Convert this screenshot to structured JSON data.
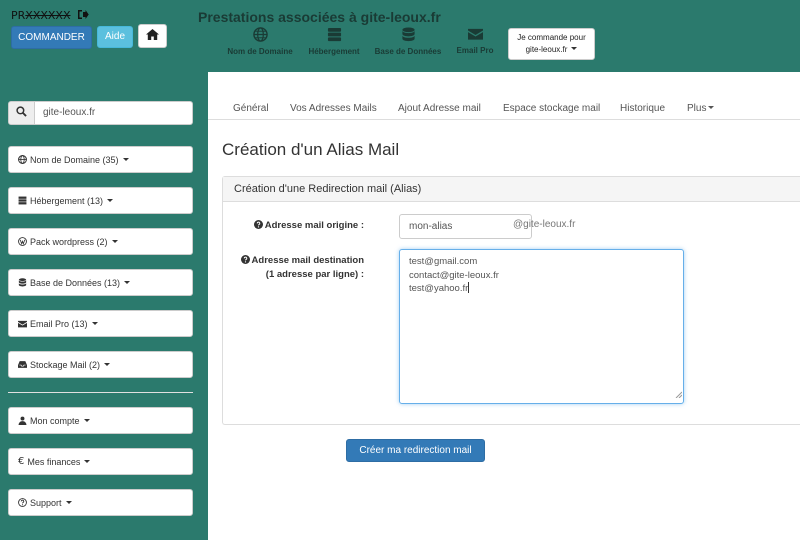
{
  "header": {
    "brand_prefix": "PR",
    "brand_masked": "XXXXXX",
    "commander_label": "COMMANDER",
    "aide_label": "Aide",
    "site_title": "Prestations associées à gite-leoux.fr",
    "nav": [
      {
        "label": "Nom de Domaine",
        "icon": "globe-icon"
      },
      {
        "label": "Hébergement",
        "icon": "server-icon"
      },
      {
        "label": "Base de Données",
        "icon": "database-icon"
      },
      {
        "label": "Email Pro",
        "icon": "envelope-icon"
      }
    ],
    "cmd_line1": "Je commande pour",
    "cmd_line2": "gite-leoux.fr"
  },
  "sidebar": {
    "search_value": "gite-leoux.fr",
    "items": [
      {
        "label": "Nom de Domaine (35)",
        "icon": "globe-icon"
      },
      {
        "label": "Hébergement (13)",
        "icon": "server-icon"
      },
      {
        "label": "Pack wordpress (2)",
        "icon": "wordpress-icon"
      },
      {
        "label": "Base de Données (13)",
        "icon": "database-icon"
      },
      {
        "label": "Email Pro (13)",
        "icon": "envelope-icon"
      },
      {
        "label": "Stockage Mail (2)",
        "icon": "inbox-icon"
      },
      {
        "label": "Mon compte",
        "icon": "user-icon"
      },
      {
        "label": "Mes finances",
        "icon": "euro-icon"
      },
      {
        "label": "Support",
        "icon": "question-circle-icon"
      }
    ]
  },
  "tabs": [
    {
      "label": "Général"
    },
    {
      "label": "Vos Adresses Mails"
    },
    {
      "label": "Ajout Adresse mail"
    },
    {
      "label": "Espace stockage mail"
    },
    {
      "label": "Historique"
    },
    {
      "label": "Plus"
    }
  ],
  "main": {
    "page_title": "Création d'un Alias Mail",
    "panel_heading": "Création d'une Redirection mail (Alias)",
    "origin_label": "Adresse mail origine :",
    "origin_value": "mon-alias",
    "origin_suffix": "@gite-leoux.fr",
    "dest_label_line1": "Adresse mail destination",
    "dest_label_line2": "(1 adresse par ligne) :",
    "dest_lines": [
      "test@gmail.com",
      "contact@gite-leoux.fr",
      "test@yahoo.fr"
    ],
    "submit_label": "Créer ma redirection mail"
  },
  "colors": {
    "brand_teal": "#2b7a6d",
    "primary": "#337ab7",
    "info": "#5bc0de"
  }
}
